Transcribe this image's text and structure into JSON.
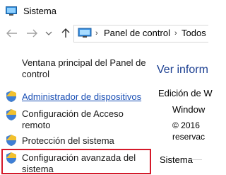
{
  "window": {
    "title": "Sistema"
  },
  "address_bar": {
    "crumbs": [
      "Panel de control",
      "Todos"
    ]
  },
  "left_pane": {
    "home_link": "Ventana principal del Panel de control",
    "links": [
      {
        "label": "Administrador de dispositivos",
        "icon": "shield-icon",
        "style": "link"
      },
      {
        "label": "Configuración de Acceso remoto",
        "icon": "shield-icon",
        "style": "text"
      },
      {
        "label": "Protección del sistema",
        "icon": "shield-icon",
        "style": "text"
      },
      {
        "label": "Configuración avanzada del sistema",
        "icon": "shield-icon",
        "style": "text",
        "highlighted": true
      }
    ]
  },
  "right_pane": {
    "heading": "Ver inform",
    "edition_label": "Edición de W",
    "windows_text": "Window",
    "copyright_line1": "© 2016",
    "copyright_line2": "reservac",
    "section_label": "Sistema"
  },
  "colors": {
    "highlight_border": "#d5192a",
    "link": "#1a4fb5",
    "heading": "#1b3f91"
  }
}
